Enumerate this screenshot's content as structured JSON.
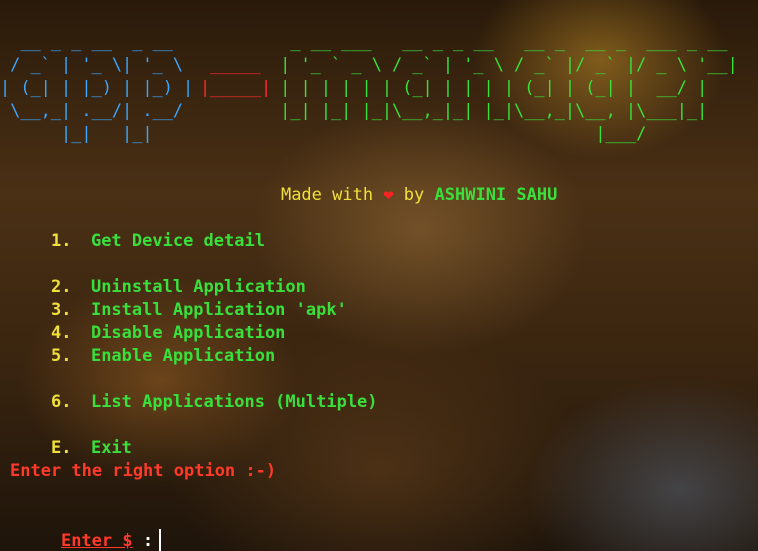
{
  "banner": {
    "logo_left": [
      "  __ _ _ __  _ __ ",
      " / _` | '_ \\| '_ \\",
      "| (_| | |_) | |_) |",
      " \\__,_| .__/| .__/",
      "      |_|   |_|   "
    ],
    "logo_dash": [
      "",
      "_____",
      "|_____|",
      "",
      ""
    ],
    "logo_right": [
      "  _ __ ___   __ _ _ __   __ _  __ _  ___ _ __",
      " | '_ ` _ \\ / _` | '_ \\ / _` |/ _` |/ _ \\ '__|",
      " | | | | | | (_| | | | | (_| | (_| |  __/ |",
      " |_| |_| |_|\\__,_|_| |_|\\__,_|\\__, |\\___|_|",
      "                                |___/"
    ]
  },
  "credit": {
    "prefix": "Made with ",
    "heart": "❤",
    "middle": " by ",
    "author": "ASHWINI SAHU"
  },
  "menu": {
    "items": [
      {
        "key": "1.",
        "label": "Get Device detail"
      },
      {
        "key": "2.",
        "label": "Uninstall Application"
      },
      {
        "key": "3.",
        "label": "Install Application 'apk'"
      },
      {
        "key": "4.",
        "label": "Disable Application"
      },
      {
        "key": "5.",
        "label": "Enable Application"
      },
      {
        "key": "6.",
        "label": "List Applications (Multiple)"
      },
      {
        "key": "E.",
        "label": "Exit"
      }
    ]
  },
  "prompt": {
    "message": "Enter the right option :-)",
    "label": "Enter $",
    "separator": " :",
    "input_value": ""
  },
  "colors": {
    "menu_number": "#f0e13a",
    "menu_label": "#39e03c",
    "prompt": "#ff3a2a",
    "logo_left": "#3aa6ff",
    "logo_dash": "#ff2a2a",
    "logo_right": "#39e03c"
  }
}
